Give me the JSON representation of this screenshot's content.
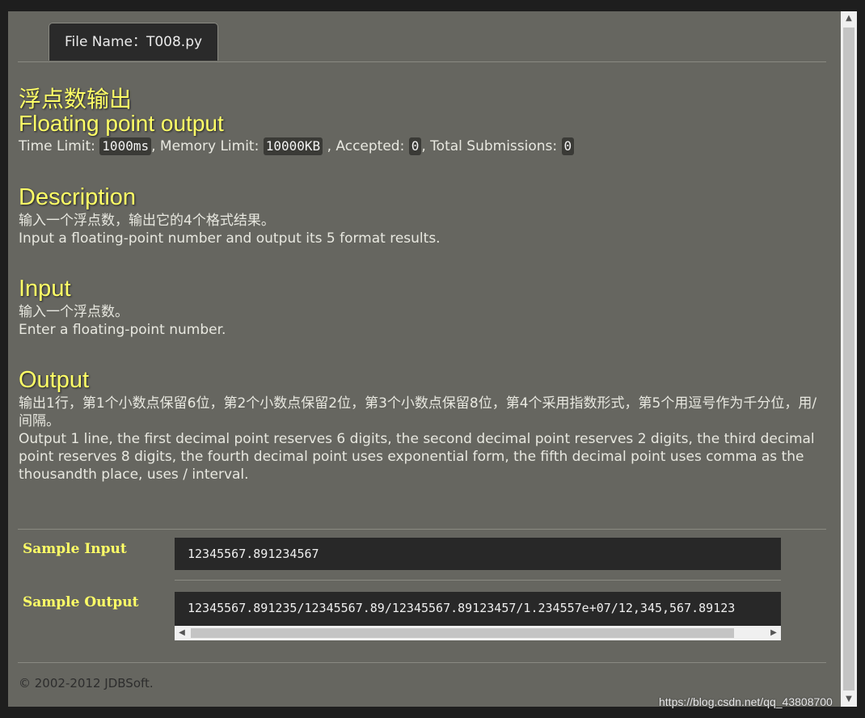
{
  "tab": {
    "label": "File Name：T008.py"
  },
  "problem": {
    "title_cn": "浮点数输出",
    "title_en": "Floating point output",
    "time_limit_label": "Time Limit:",
    "time_limit": "1000ms",
    "memory_limit_label": ", Memory Limit:",
    "memory_limit": "10000KB",
    "accepted_label": ", Accepted:",
    "accepted": "0",
    "submissions_label": ", Total Submissions:",
    "submissions": "0"
  },
  "description": {
    "heading": "Description",
    "line_cn": "输入一个浮点数，输出它的4个格式结果。",
    "line_en": "Input a floating-point number and output its 5 format results."
  },
  "input": {
    "heading": "Input",
    "line_cn": "输入一个浮点数。",
    "line_en": "Enter a floating-point number."
  },
  "output": {
    "heading": "Output",
    "line_cn": "输出1行，第1个小数点保留6位，第2个小数点保留2位，第3个小数点保留8位，第4个采用指数形式，第5个用逗号作为千分位，用/间隔。",
    "line_en": "Output 1 line, the first decimal point reserves 6 digits, the second decimal point reserves 2 digits, the third decimal point reserves 8 digits, the fourth decimal point uses exponential form, the fifth decimal point uses comma as the thousandth place, uses / interval."
  },
  "samples": {
    "input_label": "Sample Input",
    "input_value": "12345567.891234567",
    "output_label": "Sample Output",
    "output_value": "12345567.891235/12345567.89/12345567.89123457/1.234557e+07/12,345,567.89123"
  },
  "footer": {
    "text": "© 2002-2012  JDBSoft."
  },
  "watermark": {
    "text": "https://blog.csdn.net/qq_43808700"
  }
}
